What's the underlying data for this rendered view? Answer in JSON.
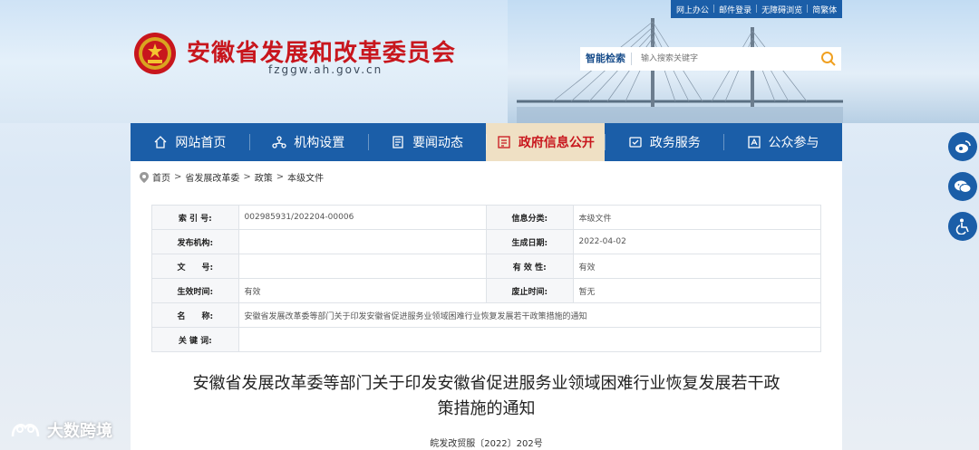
{
  "top_links": [
    "网上办公",
    "邮件登录",
    "无障碍浏览",
    "简繁体"
  ],
  "site": {
    "title": "安徽省发展和改革委员会",
    "domain": "fzggw.ah.gov.cn"
  },
  "search": {
    "label": "智能检索",
    "placeholder": "输入搜索关键字"
  },
  "nav": [
    {
      "label": "网站首页",
      "icon": "home-icon"
    },
    {
      "label": "机构设置",
      "icon": "org-icon"
    },
    {
      "label": "要闻动态",
      "icon": "news-icon"
    },
    {
      "label": "政府信息公开",
      "icon": "info-icon",
      "active": true
    },
    {
      "label": "政务服务",
      "icon": "service-icon"
    },
    {
      "label": "公众参与",
      "icon": "participate-icon"
    }
  ],
  "breadcrumb": [
    "首页",
    "省发展改革委",
    "政策",
    "本级文件"
  ],
  "info": {
    "index_label": "索 引 号:",
    "index_value": "002985931/202204-00006",
    "category_label": "信息分类:",
    "category_value": "本级文件",
    "publisher_label": "发布机构:",
    "publisher_value": "",
    "date_label": "生成日期:",
    "date_value": "2022-04-02",
    "docno_label": "文　　号:",
    "docno_value": "",
    "validity_label": "有 效 性:",
    "validity_value": "有效",
    "effective_label": "生效时间:",
    "effective_value": "有效",
    "repeal_label": "废止时间:",
    "repeal_value": "暂无",
    "name_label": "名　　称:",
    "name_value": "安徽省发展改革委等部门关于印发安徽省促进服务业领域困难行业恢复发展若干政策措施的通知",
    "keywords_label": "关 键 词:",
    "keywords_value": ""
  },
  "document": {
    "title_line1": "安徽省发展改革委等部门关于印发安徽省促进服务业领域困难行业恢复发展若干政",
    "title_line2": "策措施的通知",
    "number": "皖发改贸服〔2022〕202号"
  },
  "share": [
    "weibo-icon",
    "wechat-icon",
    "accessibility-icon"
  ],
  "watermark": "大数跨境",
  "colors": {
    "nav_blue": "#1b5ea8",
    "title_red": "#c8161d",
    "active_tab_bg": "#efe0c4"
  }
}
